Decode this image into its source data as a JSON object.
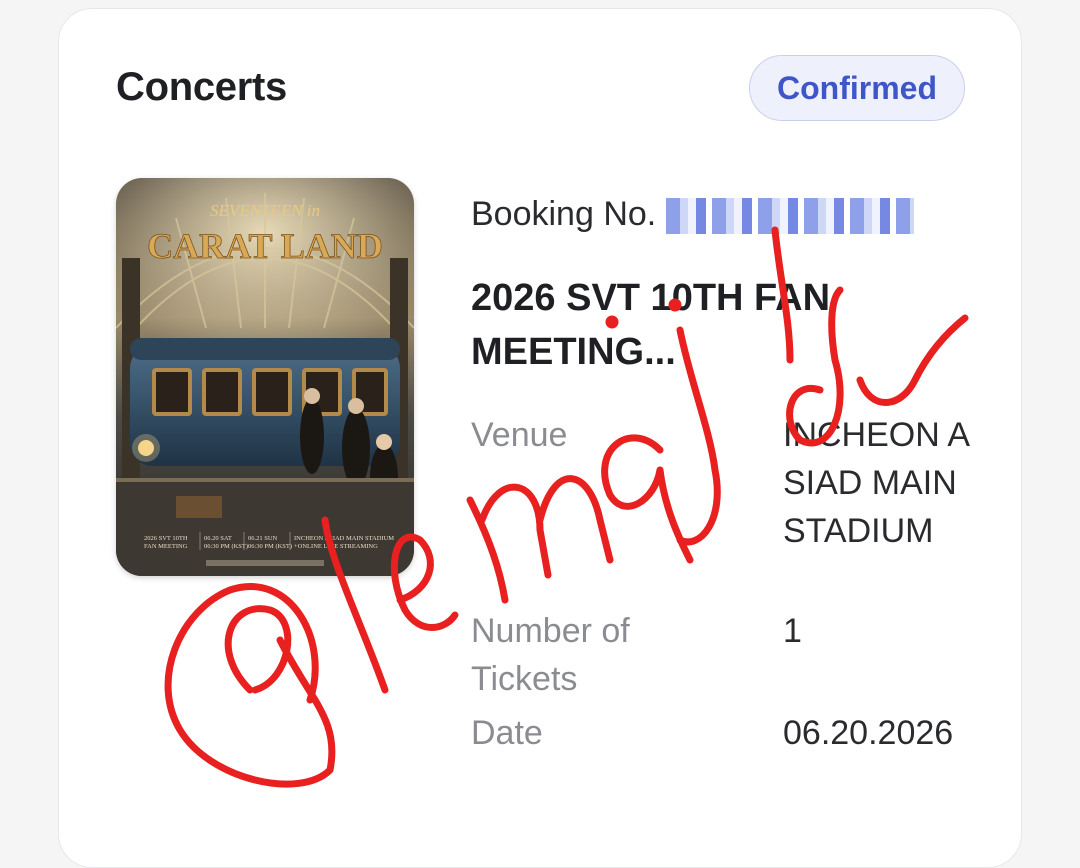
{
  "section": {
    "title": "Concerts",
    "status": "Confirmed"
  },
  "poster": {
    "title_line1": "SEVENTEEN in",
    "title_line2": "CARAT LAND",
    "footer_event": "2026 SVT 10TH\nFAN MEETING",
    "footer_date1": "06.20 SAT\n06:30 PM (KST)",
    "footer_date2": "06.21 SUN\n06:30 PM (KST)",
    "footer_venue": "INCHEON ASIAD MAIN STADIUM\n+ONLINE LIVE STREAMING"
  },
  "booking": {
    "label": "Booking No."
  },
  "event": {
    "title": "2026 SVT 10TH FAN MEETING..."
  },
  "details": {
    "venue_label": "Venue",
    "venue_value": "INCHEON ASIAD MAIN STADIUM",
    "tickets_label": "Number of Tickets",
    "tickets_value": "1",
    "date_label": "Date",
    "date_value": "06.20.2026"
  },
  "colors": {
    "accent": "#3e56c7",
    "badge_bg": "#eef1fb",
    "watermark": "#e8201f"
  }
}
